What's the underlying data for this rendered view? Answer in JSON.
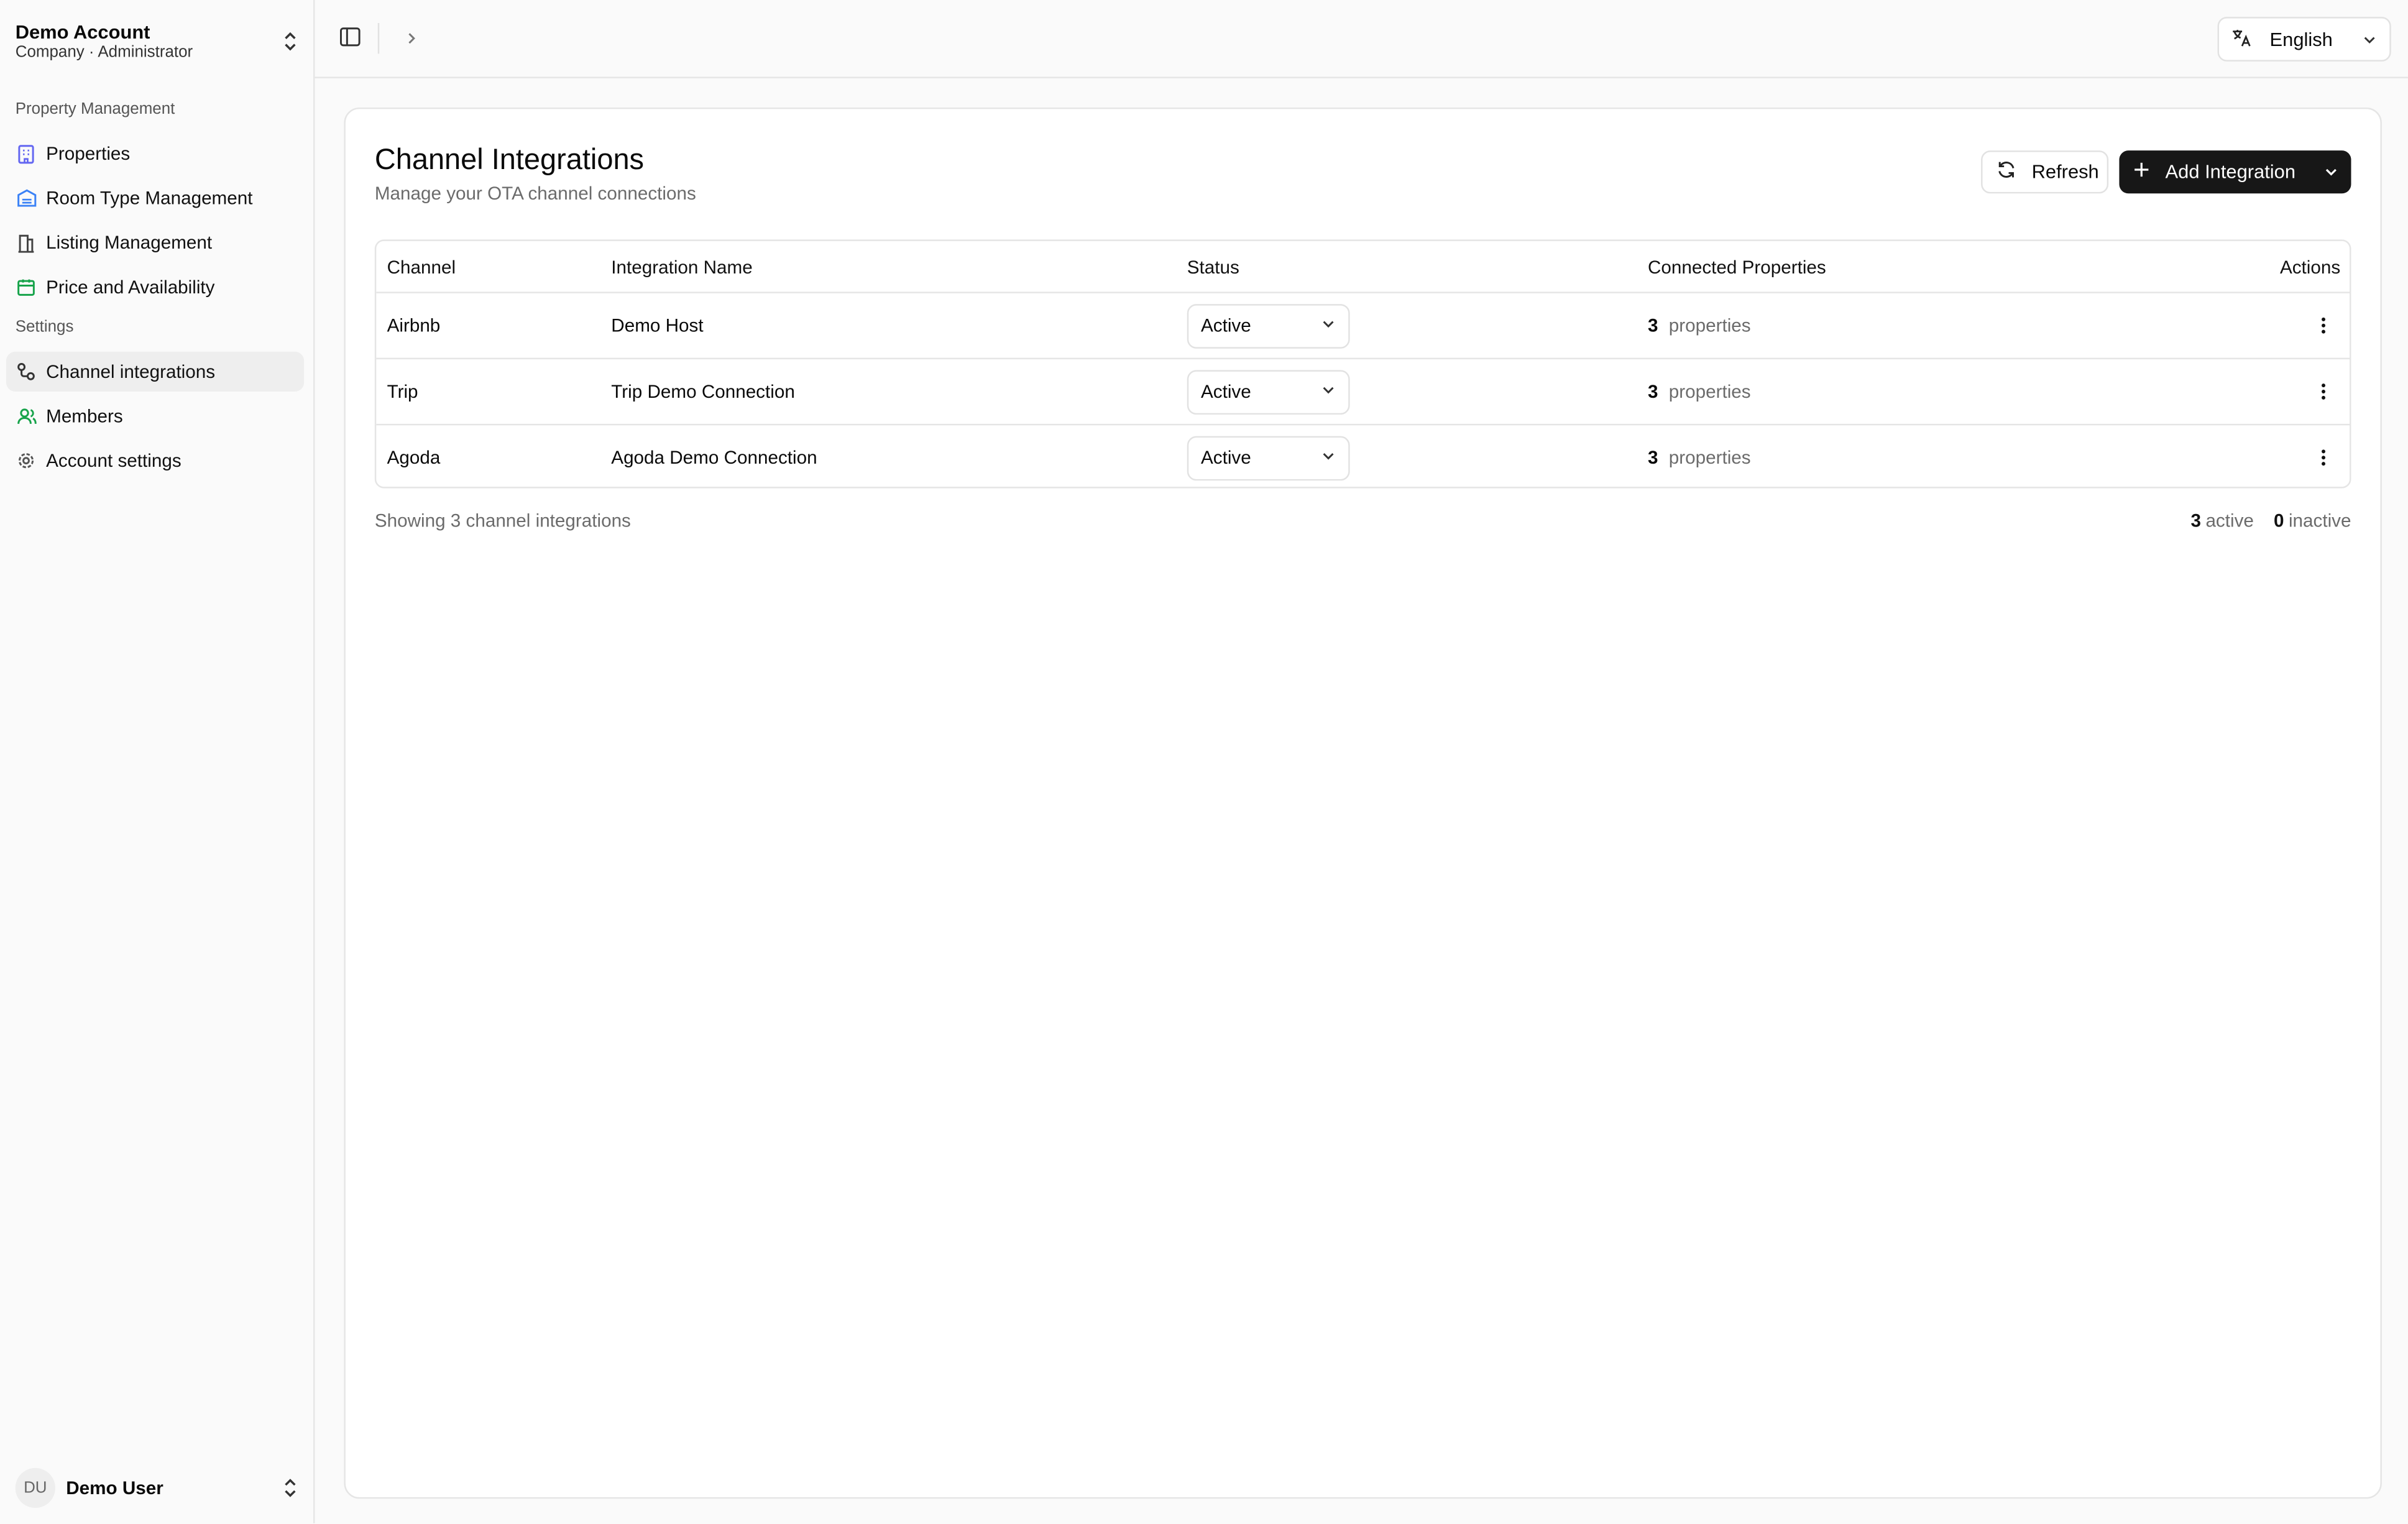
{
  "sidebar": {
    "account": {
      "name": "Demo Account",
      "subtitle": "Company · Administrator"
    },
    "group_property": "Property Management",
    "items_property": [
      {
        "label": "Properties",
        "icon": "building-icon"
      },
      {
        "label": "Room Type Management",
        "icon": "hotel-icon"
      },
      {
        "label": "Listing Management",
        "icon": "listing-icon"
      },
      {
        "label": "Price and Availability",
        "icon": "calendar-icon"
      }
    ],
    "group_settings": "Settings",
    "items_settings": [
      {
        "label": "Channel integrations",
        "icon": "link-icon",
        "active": true
      },
      {
        "label": "Members",
        "icon": "users-icon"
      },
      {
        "label": "Account settings",
        "icon": "gear-icon"
      }
    ],
    "user": {
      "initials": "DU",
      "name": "Demo User"
    }
  },
  "topbar": {
    "language": "English"
  },
  "page": {
    "title": "Channel Integrations",
    "subtitle": "Manage your OTA channel connections",
    "refresh_label": "Refresh",
    "add_label": "Add Integration"
  },
  "table": {
    "columns": [
      "Channel",
      "Integration Name",
      "Status",
      "Connected Properties",
      "Actions"
    ],
    "rows": [
      {
        "channel": "Airbnb",
        "name": "Demo Host",
        "status": "Active",
        "count": "3",
        "unit": "properties"
      },
      {
        "channel": "Trip",
        "name": "Trip Demo Connection",
        "status": "Active",
        "count": "3",
        "unit": "properties"
      },
      {
        "channel": "Agoda",
        "name": "Agoda Demo Connection",
        "status": "Active",
        "count": "3",
        "unit": "properties"
      }
    ]
  },
  "footer": {
    "showing": "Showing 3 channel integrations",
    "active_count": "3",
    "active_label": "active",
    "inactive_count": "0",
    "inactive_label": "inactive"
  },
  "colors": {
    "primary_button": "#171717",
    "icon_purple": "#6366f1",
    "icon_blue": "#3b82f6",
    "icon_green": "#16a34a"
  }
}
